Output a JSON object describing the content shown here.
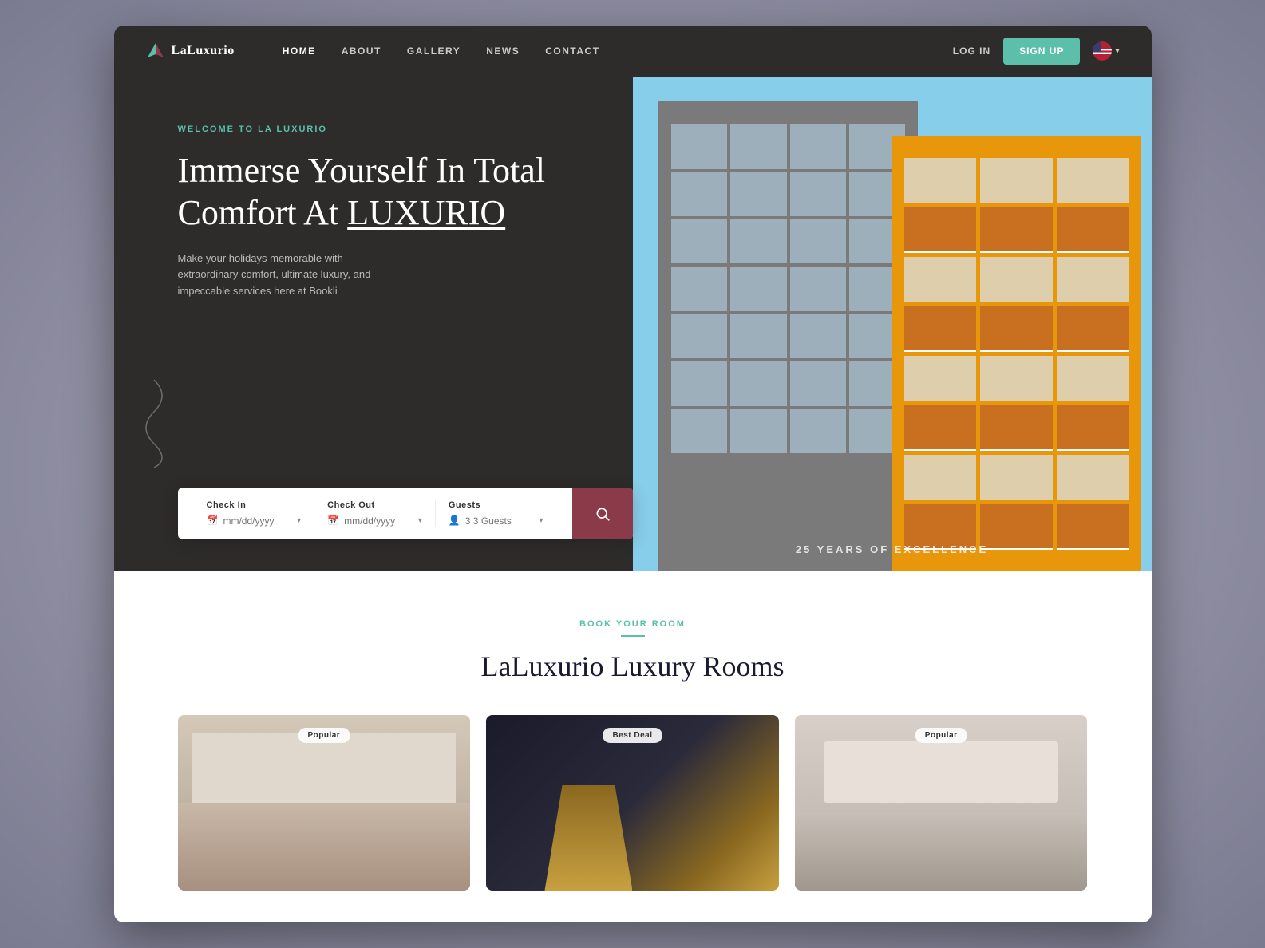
{
  "brand": {
    "name": "LaLuxurio",
    "logo_alt": "LaLuxurio logo"
  },
  "navbar": {
    "links": [
      {
        "id": "home",
        "label": "HOME",
        "active": true
      },
      {
        "id": "about",
        "label": "ABOUT",
        "active": false
      },
      {
        "id": "gallery",
        "label": "GALLERY",
        "active": false
      },
      {
        "id": "news",
        "label": "NEWS",
        "active": false
      },
      {
        "id": "contact",
        "label": "CONTACT",
        "active": false
      }
    ],
    "login_label": "LOG IN",
    "signup_label": "SIGN UP",
    "language": "EN"
  },
  "hero": {
    "welcome_label": "WELCOME TO LA LUXURIO",
    "title_line1": "Immerse Yourself In Total",
    "title_line2": "Comfort At ",
    "title_brand": "LUXURIO",
    "subtitle": "Make your holidays memorable with extraordinary comfort, ultimate luxury, and impeccable services here at Bookli",
    "excellence_badge": "25 YEARS OF EXCELLENCE"
  },
  "booking_form": {
    "check_in_label": "Check In",
    "check_in_placeholder": "mm/dd/yyyy",
    "check_out_label": "Check Out",
    "check_out_placeholder": "mm/dd/yyyy",
    "guests_label": "Guests",
    "guests_placeholder": "3 3 Guests",
    "search_icon": "search-icon"
  },
  "rooms_section": {
    "section_label": "BOOK YOUR ROOM",
    "section_title": "LaLuxurio Luxury Rooms",
    "rooms": [
      {
        "id": 1,
        "badge": "Popular",
        "img_type": "light"
      },
      {
        "id": 2,
        "badge": "Best Deal",
        "img_type": "dark"
      },
      {
        "id": 3,
        "badge": "Popular",
        "img_type": "medium"
      }
    ]
  }
}
